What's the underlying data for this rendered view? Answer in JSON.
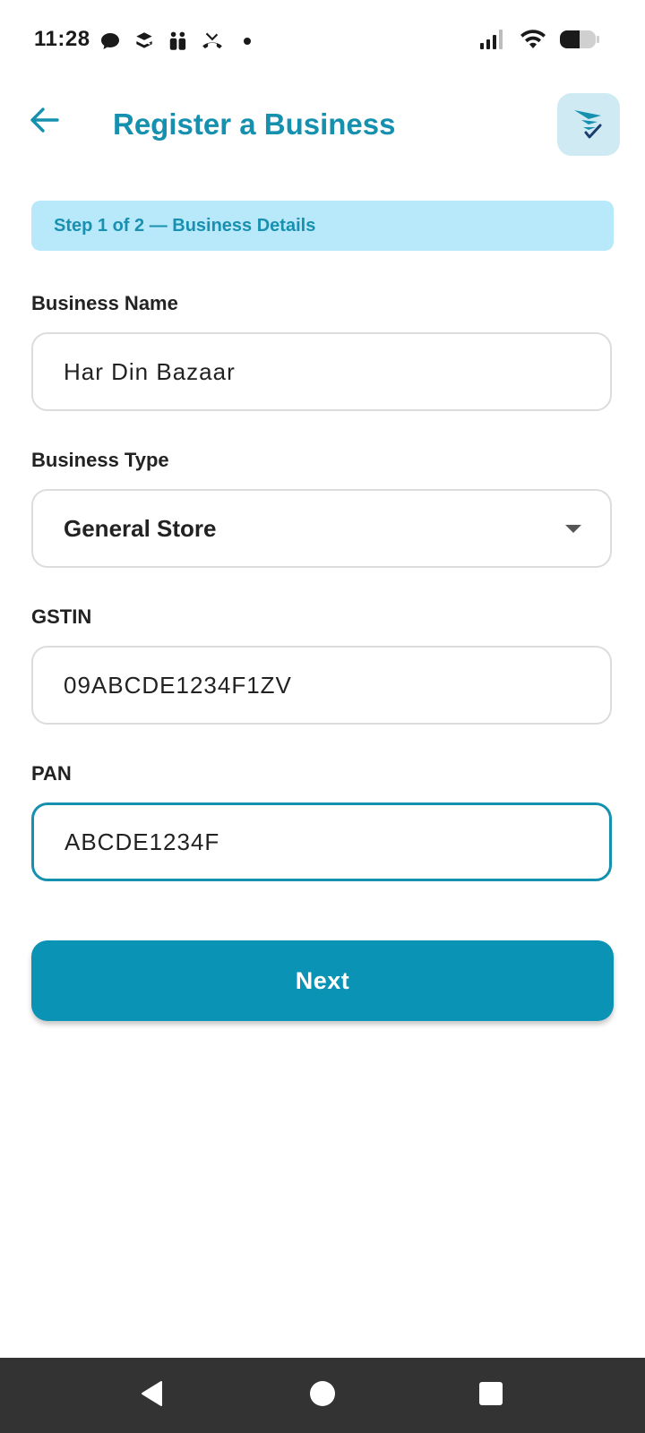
{
  "status_bar": {
    "time": "11:28",
    "left_icons": [
      "chat-bubble-icon",
      "layers-icon",
      "people-icon",
      "missed-call-icon",
      "notification-dot-icon"
    ],
    "right_icons": [
      "signal-icon",
      "wifi-icon",
      "battery-icon"
    ]
  },
  "header": {
    "title": "Register a Business",
    "back_icon": "arrow-left-icon",
    "logo_icon": "app-logo-icon"
  },
  "step_banner": {
    "text": "Step 1 of 2 — Business Details"
  },
  "form": {
    "business_name": {
      "label": "Business Name",
      "value": "Har Din Bazaar"
    },
    "business_type": {
      "label": "Business Type",
      "value": "General Store"
    },
    "gstin": {
      "label": "GSTIN",
      "value": "09ABCDE1234F1ZV"
    },
    "pan": {
      "label": "PAN",
      "value": "ABCDE1234F"
    }
  },
  "next_button": {
    "label": "Next"
  },
  "nav_bar": {
    "buttons": [
      "back-triangle-icon",
      "home-circle-icon",
      "recents-square-icon"
    ]
  },
  "colors": {
    "accent": "#1590ae",
    "button": "#0b93b5",
    "banner_bg": "#b7e9fb",
    "nav_bg": "#333333"
  }
}
